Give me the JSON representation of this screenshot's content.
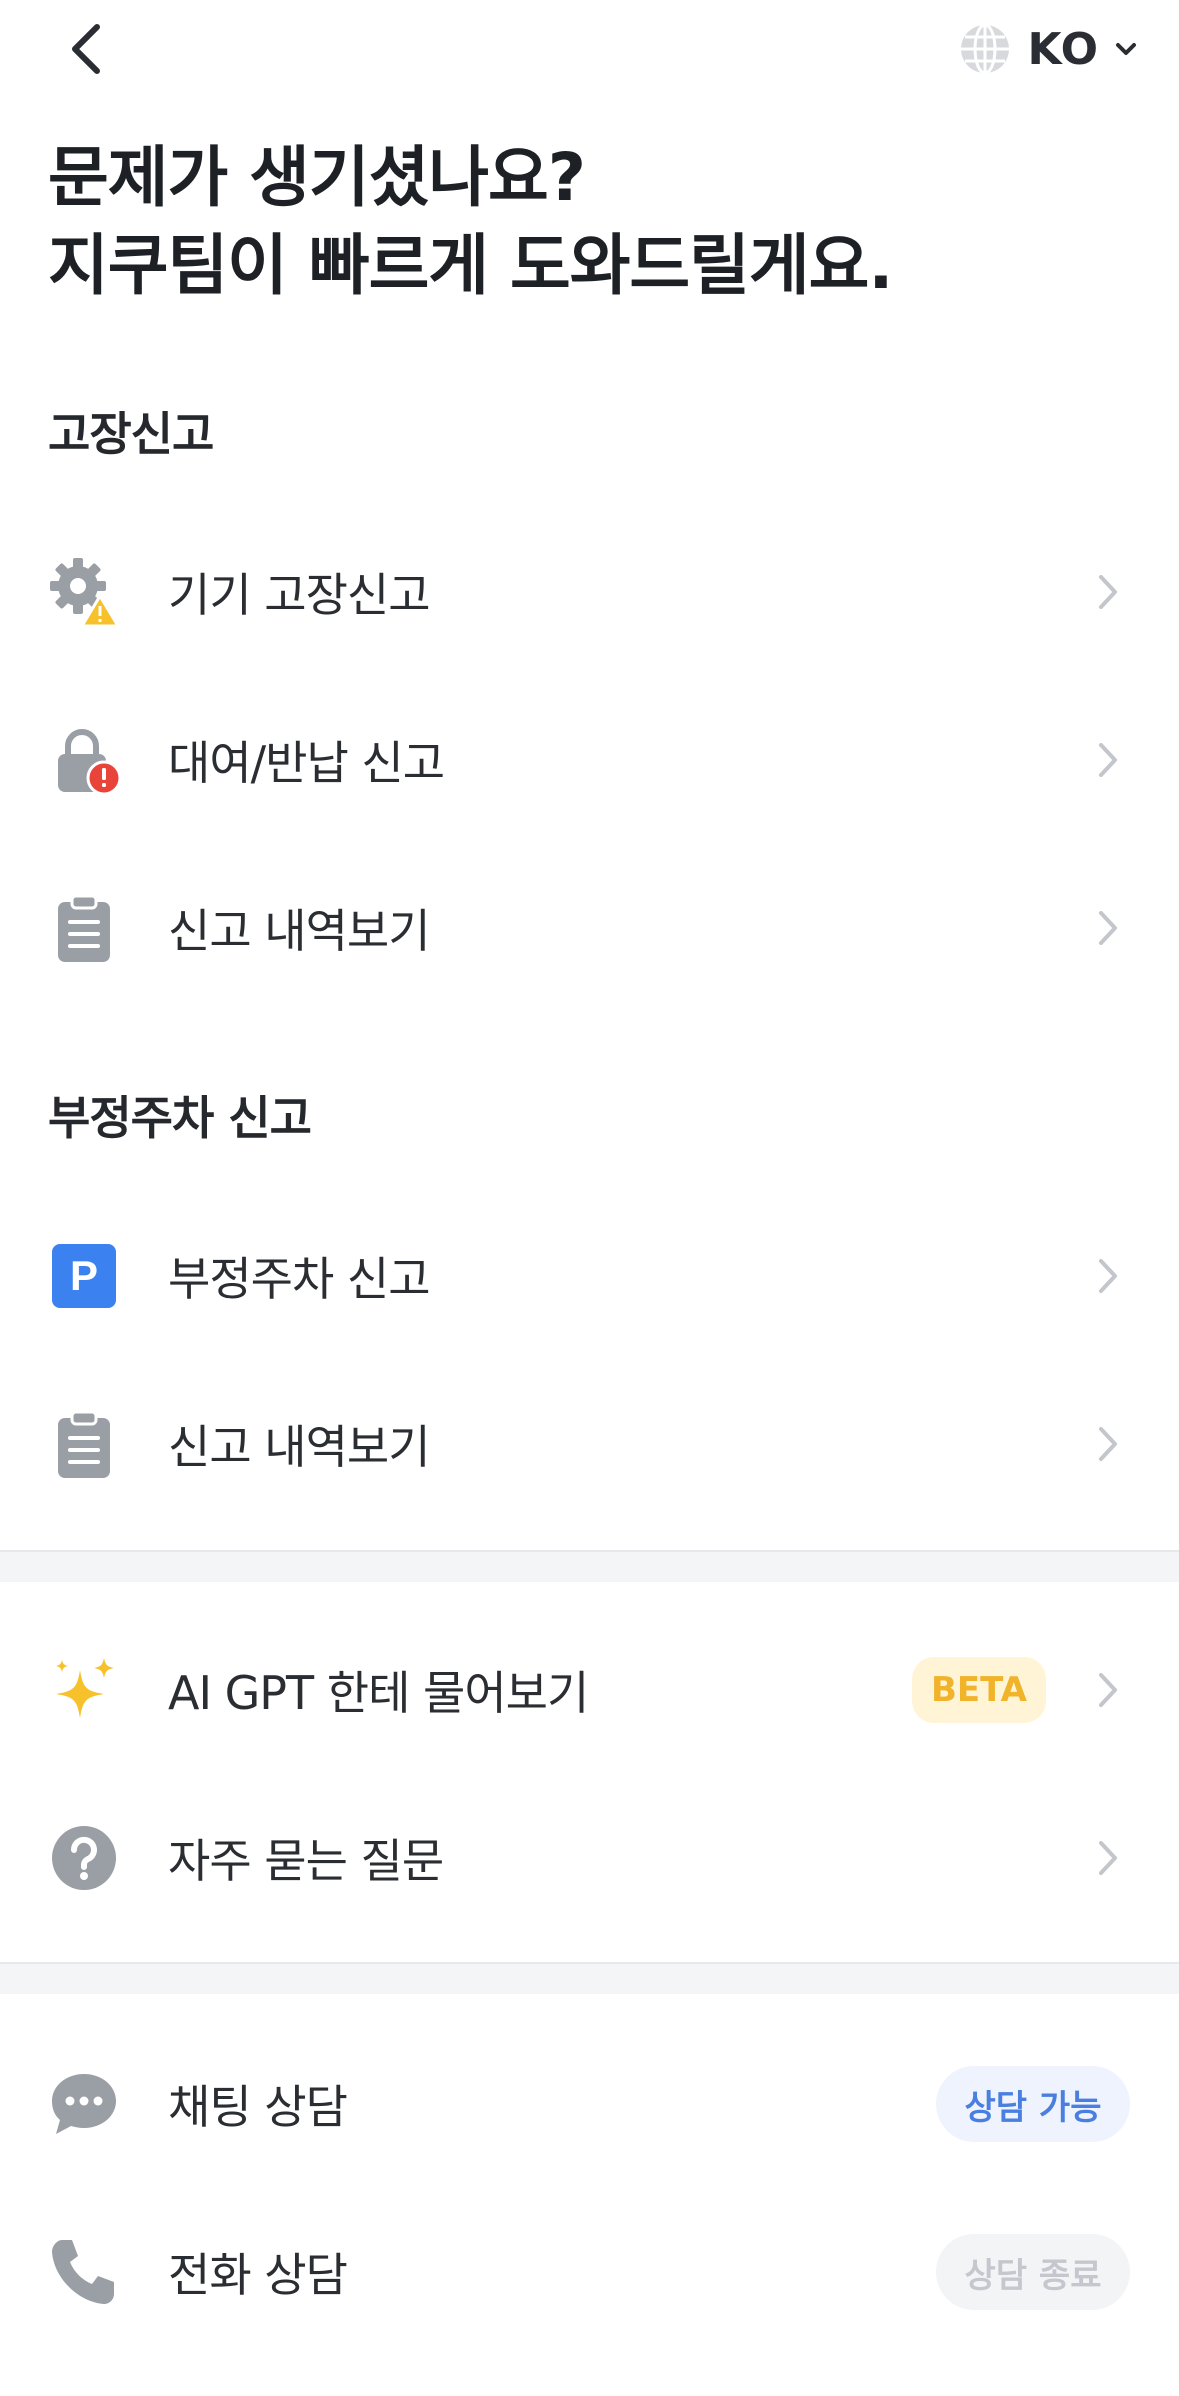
{
  "header": {
    "lang_code": "KO"
  },
  "headline": {
    "line1": "문제가 생기셨나요?",
    "line2": "지쿠팀이 빠르게 도와드릴게요."
  },
  "sections": {
    "breakdown_title": "고장신고",
    "parking_title": "부정주차 신고"
  },
  "breakdown_items": [
    {
      "label": "기기 고장신고",
      "icon": "gear-warning-icon"
    },
    {
      "label": "대여/반납 신고",
      "icon": "lock-alert-icon"
    },
    {
      "label": "신고 내역보기",
      "icon": "clipboard-icon"
    }
  ],
  "parking_items": [
    {
      "label": "부정주차 신고",
      "icon": "parking-icon"
    },
    {
      "label": "신고 내역보기",
      "icon": "clipboard-icon"
    }
  ],
  "help_items": [
    {
      "label": "AI GPT 한테 물어보기",
      "icon": "sparkle-icon",
      "badge": "BETA"
    },
    {
      "label": "자주 묻는 질문",
      "icon": "question-icon"
    }
  ],
  "contact_items": [
    {
      "label": "채팅 상담",
      "icon": "chat-icon",
      "status": "상담 가능"
    },
    {
      "label": "전화 상담",
      "icon": "phone-icon",
      "status": "상담 종료"
    }
  ],
  "colors": {
    "accent_blue": "#3b82f0",
    "beta_bg": "#fff4d6",
    "beta_text": "#f0b32a",
    "available_bg": "#eef3fd",
    "available_text": "#4a7fe0",
    "closed_bg": "#f3f4f6",
    "closed_text": "#c4c8ce",
    "warning_yellow": "#f6c12b",
    "alert_red": "#e8443a",
    "icon_gray": "#9a9ea5"
  }
}
